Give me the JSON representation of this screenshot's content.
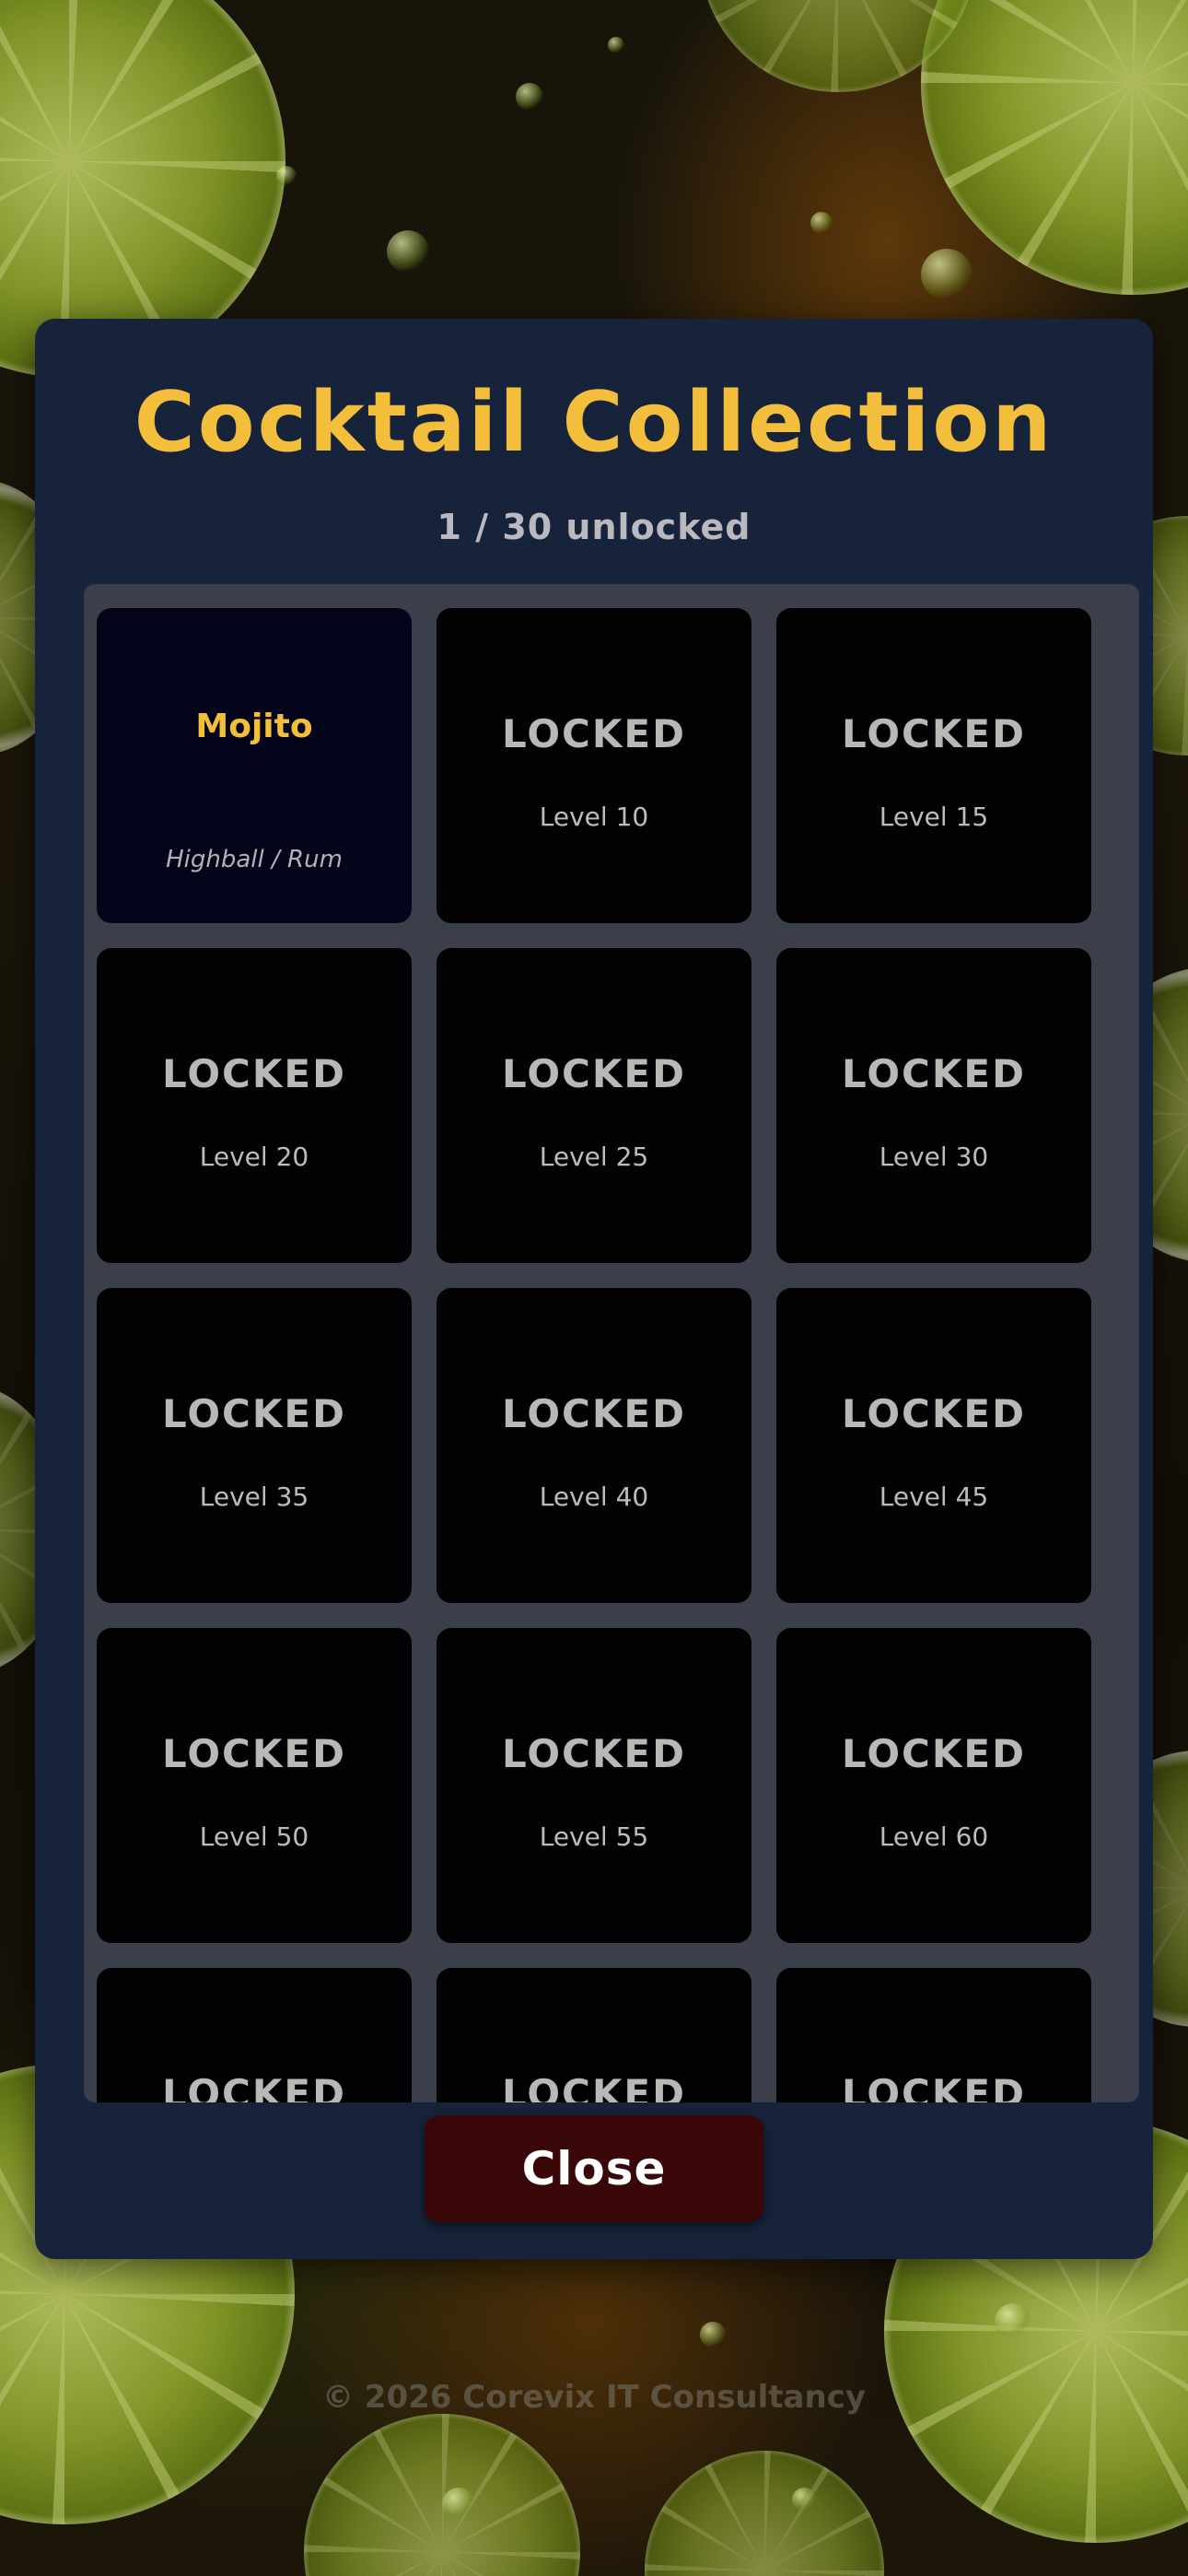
{
  "modal": {
    "title": "Cocktail Collection",
    "counter": "1 / 30 unlocked"
  },
  "cards": [
    {
      "name": "Mojito",
      "meta": "Highball / Rum"
    },
    {
      "status": "LOCKED",
      "level": "Level 10"
    },
    {
      "status": "LOCKED",
      "level": "Level 15"
    },
    {
      "status": "LOCKED",
      "level": "Level 20"
    },
    {
      "status": "LOCKED",
      "level": "Level 25"
    },
    {
      "status": "LOCKED",
      "level": "Level 30"
    },
    {
      "status": "LOCKED",
      "level": "Level 35"
    },
    {
      "status": "LOCKED",
      "level": "Level 40"
    },
    {
      "status": "LOCKED",
      "level": "Level 45"
    },
    {
      "status": "LOCKED",
      "level": "Level 50"
    },
    {
      "status": "LOCKED",
      "level": "Level 55"
    },
    {
      "status": "LOCKED",
      "level": "Level 60"
    },
    {
      "status": "LOCKED"
    },
    {
      "status": "LOCKED"
    },
    {
      "status": "LOCKED"
    }
  ],
  "close_label": "Close",
  "footer": "© 2026 Corevix IT Consultancy",
  "colors": {
    "accent": "#f2be3b",
    "modal_bg": "#16233a",
    "card_bg": "#020204",
    "close_bg": "#3a0708"
  }
}
